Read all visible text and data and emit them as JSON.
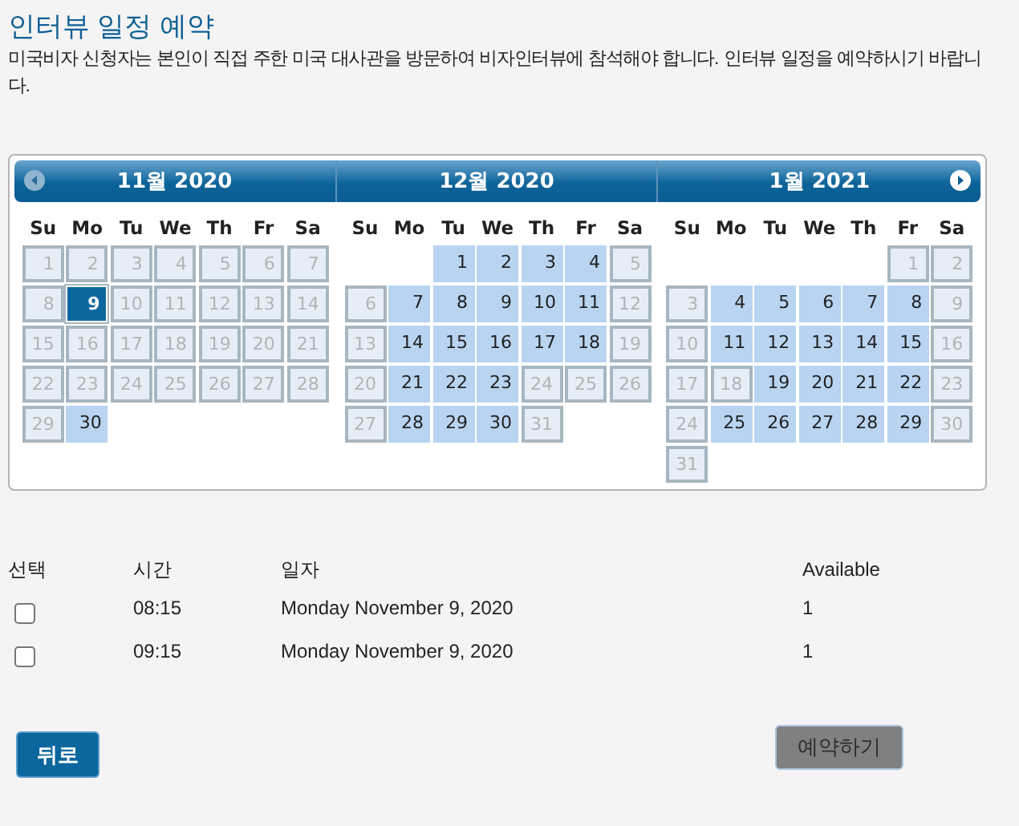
{
  "title": "인터뷰 일정 예약",
  "intro": "미국비자 신청자는 본인이 직접 주한 미국 대사관을 방문하여 비자인터뷰에 참석해야 합니다. 인터뷰 일정을 예약하시기 바랍니다.",
  "calendar": {
    "months": [
      {
        "title": "11월 2020",
        "weekdays": [
          "Su",
          "Mo",
          "Tu",
          "We",
          "Th",
          "Fr",
          "Sa"
        ],
        "weeks": [
          [
            {
              "day": "1",
              "available": false,
              "selected": false
            },
            {
              "day": "2",
              "available": false,
              "selected": false
            },
            {
              "day": "3",
              "available": false,
              "selected": false
            },
            {
              "day": "4",
              "available": false,
              "selected": false
            },
            {
              "day": "5",
              "available": false,
              "selected": false
            },
            {
              "day": "6",
              "available": false,
              "selected": false
            },
            {
              "day": "7",
              "available": false,
              "selected": false
            }
          ],
          [
            {
              "day": "8",
              "available": false,
              "selected": false
            },
            {
              "day": "9",
              "available": true,
              "selected": true
            },
            {
              "day": "10",
              "available": false,
              "selected": false
            },
            {
              "day": "11",
              "available": false,
              "selected": false
            },
            {
              "day": "12",
              "available": false,
              "selected": false
            },
            {
              "day": "13",
              "available": false,
              "selected": false
            },
            {
              "day": "14",
              "available": false,
              "selected": false
            }
          ],
          [
            {
              "day": "15",
              "available": false,
              "selected": false
            },
            {
              "day": "16",
              "available": false,
              "selected": false
            },
            {
              "day": "17",
              "available": false,
              "selected": false
            },
            {
              "day": "18",
              "available": false,
              "selected": false
            },
            {
              "day": "19",
              "available": false,
              "selected": false
            },
            {
              "day": "20",
              "available": false,
              "selected": false
            },
            {
              "day": "21",
              "available": false,
              "selected": false
            }
          ],
          [
            {
              "day": "22",
              "available": false,
              "selected": false
            },
            {
              "day": "23",
              "available": false,
              "selected": false
            },
            {
              "day": "24",
              "available": false,
              "selected": false
            },
            {
              "day": "25",
              "available": false,
              "selected": false
            },
            {
              "day": "26",
              "available": false,
              "selected": false
            },
            {
              "day": "27",
              "available": false,
              "selected": false
            },
            {
              "day": "28",
              "available": false,
              "selected": false
            }
          ],
          [
            {
              "day": "29",
              "available": false,
              "selected": false
            },
            {
              "day": "30",
              "available": true,
              "selected": false
            }
          ]
        ]
      },
      {
        "title": "12월 2020",
        "weekdays": [
          "Su",
          "Mo",
          "Tu",
          "We",
          "Th",
          "Fr",
          "Sa"
        ],
        "weeks": [
          [
            {
              "day": "1",
              "available": true,
              "selected": false
            },
            {
              "day": "2",
              "available": true,
              "selected": false
            },
            {
              "day": "3",
              "available": true,
              "selected": false
            },
            {
              "day": "4",
              "available": true,
              "selected": false
            },
            {
              "day": "5",
              "available": false,
              "selected": false
            }
          ],
          [
            {
              "day": "6",
              "available": false,
              "selected": false
            },
            {
              "day": "7",
              "available": true,
              "selected": false
            },
            {
              "day": "8",
              "available": true,
              "selected": false
            },
            {
              "day": "9",
              "available": true,
              "selected": false
            },
            {
              "day": "10",
              "available": true,
              "selected": false
            },
            {
              "day": "11",
              "available": true,
              "selected": false
            },
            {
              "day": "12",
              "available": false,
              "selected": false
            }
          ],
          [
            {
              "day": "13",
              "available": false,
              "selected": false
            },
            {
              "day": "14",
              "available": true,
              "selected": false
            },
            {
              "day": "15",
              "available": true,
              "selected": false
            },
            {
              "day": "16",
              "available": true,
              "selected": false
            },
            {
              "day": "17",
              "available": true,
              "selected": false
            },
            {
              "day": "18",
              "available": true,
              "selected": false
            },
            {
              "day": "19",
              "available": false,
              "selected": false
            }
          ],
          [
            {
              "day": "20",
              "available": false,
              "selected": false
            },
            {
              "day": "21",
              "available": true,
              "selected": false
            },
            {
              "day": "22",
              "available": true,
              "selected": false
            },
            {
              "day": "23",
              "available": true,
              "selected": false
            },
            {
              "day": "24",
              "available": false,
              "selected": false
            },
            {
              "day": "25",
              "available": false,
              "selected": false
            },
            {
              "day": "26",
              "available": false,
              "selected": false
            }
          ],
          [
            {
              "day": "27",
              "available": false,
              "selected": false
            },
            {
              "day": "28",
              "available": true,
              "selected": false
            },
            {
              "day": "29",
              "available": true,
              "selected": false
            },
            {
              "day": "30",
              "available": true,
              "selected": false
            },
            {
              "day": "31",
              "available": false,
              "selected": false
            }
          ]
        ]
      },
      {
        "title": "1월 2021",
        "weekdays": [
          "Su",
          "Mo",
          "Tu",
          "We",
          "Th",
          "Fr",
          "Sa"
        ],
        "weeks": [
          [
            {
              "day": "1",
              "available": false,
              "selected": false
            },
            {
              "day": "2",
              "available": false,
              "selected": false
            }
          ],
          [
            {
              "day": "3",
              "available": false,
              "selected": false
            },
            {
              "day": "4",
              "available": true,
              "selected": false
            },
            {
              "day": "5",
              "available": true,
              "selected": false
            },
            {
              "day": "6",
              "available": true,
              "selected": false
            },
            {
              "day": "7",
              "available": true,
              "selected": false
            },
            {
              "day": "8",
              "available": true,
              "selected": false
            },
            {
              "day": "9",
              "available": false,
              "selected": false
            }
          ],
          [
            {
              "day": "10",
              "available": false,
              "selected": false
            },
            {
              "day": "11",
              "available": true,
              "selected": false
            },
            {
              "day": "12",
              "available": true,
              "selected": false
            },
            {
              "day": "13",
              "available": true,
              "selected": false
            },
            {
              "day": "14",
              "available": true,
              "selected": false
            },
            {
              "day": "15",
              "available": true,
              "selected": false
            },
            {
              "day": "16",
              "available": false,
              "selected": false
            }
          ],
          [
            {
              "day": "17",
              "available": false,
              "selected": false
            },
            {
              "day": "18",
              "available": false,
              "selected": false
            },
            {
              "day": "19",
              "available": true,
              "selected": false
            },
            {
              "day": "20",
              "available": true,
              "selected": false
            },
            {
              "day": "21",
              "available": true,
              "selected": false
            },
            {
              "day": "22",
              "available": true,
              "selected": false
            },
            {
              "day": "23",
              "available": false,
              "selected": false
            }
          ],
          [
            {
              "day": "24",
              "available": false,
              "selected": false
            },
            {
              "day": "25",
              "available": true,
              "selected": false
            },
            {
              "day": "26",
              "available": true,
              "selected": false
            },
            {
              "day": "27",
              "available": true,
              "selected": false
            },
            {
              "day": "28",
              "available": true,
              "selected": false
            },
            {
              "day": "29",
              "available": true,
              "selected": false
            },
            {
              "day": "30",
              "available": false,
              "selected": false
            }
          ],
          [
            {
              "day": "31",
              "available": false,
              "selected": false
            }
          ]
        ]
      }
    ]
  },
  "slots": {
    "columns": [
      "선택",
      "시간",
      "일자",
      "Available"
    ],
    "rows": [
      {
        "checked": false,
        "time": "08:15",
        "date": "Monday November 9, 2020",
        "available": "1"
      },
      {
        "checked": false,
        "time": "09:15",
        "date": "Monday November 9, 2020",
        "available": "1"
      }
    ]
  },
  "buttons": {
    "back": {
      "label": "뒤로"
    },
    "reserve": {
      "label": "예약하기",
      "disabled": true
    }
  }
}
